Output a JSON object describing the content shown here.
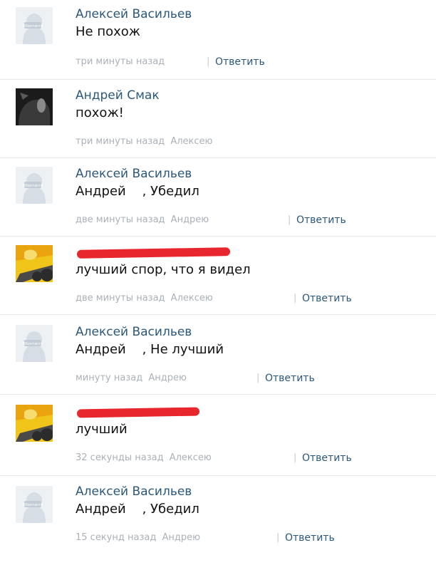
{
  "comments": [
    {
      "author": "Алексей Васильев",
      "text": "Не похож",
      "time": "три минуты назад",
      "reply_to": "",
      "reply": "Ответить"
    },
    {
      "author": "Андрей Смак",
      "text": "похож!",
      "time": "три минуты назад",
      "reply_to": "Алексею",
      "reply": ""
    },
    {
      "author": "Алексей Васильев",
      "text": "Андрей    , Убедил",
      "time": "две минуты назад",
      "reply_to": "Андрею",
      "reply": "Ответить"
    },
    {
      "author": "",
      "text": "лучший спор, что я видел",
      "time": "две минуты назад",
      "reply_to": "Алексею",
      "reply": "Ответить"
    },
    {
      "author": "Алексей Васильев",
      "text": "Андрей    , Не лучший",
      "time": "минуту назад",
      "reply_to": "Андрею",
      "reply": "Ответить"
    },
    {
      "author": "",
      "text": "лучший",
      "time": "32 секунды назад",
      "reply_to": "Алексею",
      "reply": "Ответить"
    },
    {
      "author": "Алексей Васильев",
      "text": "Андрей    , Убедил",
      "time": "15 секунд назад",
      "reply_to": "Андрею",
      "reply": "Ответить"
    }
  ],
  "colors": {
    "link": "#2b587a",
    "meta": "#a9b1b9",
    "redaction": "#e8262d",
    "divider": "#e3e6ea"
  },
  "icons": {
    "default_avatar": "camera-placeholder-avatar",
    "dark_avatar": "dark-photo-avatar",
    "cartoon_avatar": "cartoon-character-avatar"
  }
}
